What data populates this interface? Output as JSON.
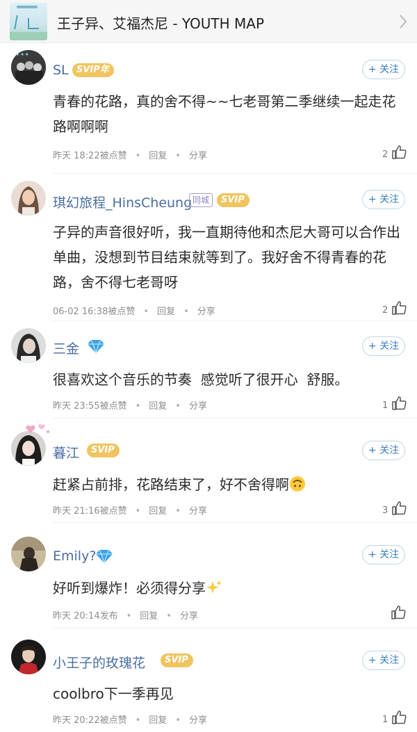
{
  "header": {
    "title": "王子异、艾福杰尼 - YOUTH MAP"
  },
  "follow_label": "+ 关注",
  "reply_label": "回复",
  "share_label": "分享",
  "comments": [
    {
      "username": "SL",
      "badge": "SVIP年",
      "text": "青春的花路，真的舍不得~~七老哥第二季继续一起走花路啊啊啊",
      "time": "昨天 18:22被点赞",
      "likes": "2"
    },
    {
      "username": "琪幻旅程_HinsCheung",
      "city_badge": "同城",
      "badge": "SVIP",
      "text": "子异的声音很好听，我一直期待他和杰尼大哥可以合作出单曲，没想到节目结束就等到了。我好舍不得青春的花路，舍不得七老哥呀",
      "time": "06-02 16:38被点赞",
      "likes": "2"
    },
    {
      "username": "三金",
      "text": "很喜欢这个音乐的节奏  感觉听了很开心  舒服。",
      "time": "昨天 23:55被点赞",
      "likes": "1"
    },
    {
      "username": "暮江",
      "badge": "SVIP",
      "text": "赶紧占前排，花路结束了，好不舍得啊",
      "time": "昨天 21:16被点赞",
      "likes": "3"
    },
    {
      "username": "Emily?",
      "text": "好听到爆炸！必须得分享",
      "time": "昨天 20:14发布",
      "likes": ""
    },
    {
      "username": "小王子的玫瑰花",
      "badge": "SVIP",
      "text": "coolbro下一季再见",
      "time": "昨天 20:22被点赞",
      "likes": "1"
    }
  ],
  "colors": {
    "username": "#4a6da0",
    "svip_badge": "#f1c45f",
    "follow_border": "#bfd6e8",
    "follow_text": "#3a7ec2",
    "diamond": "#3aa2e8"
  },
  "icons": [
    "chevron-right-icon",
    "thumbs-up-icon",
    "diamond-vip-icon",
    "upside-down-face-emoji",
    "sparkles-emoji"
  ]
}
